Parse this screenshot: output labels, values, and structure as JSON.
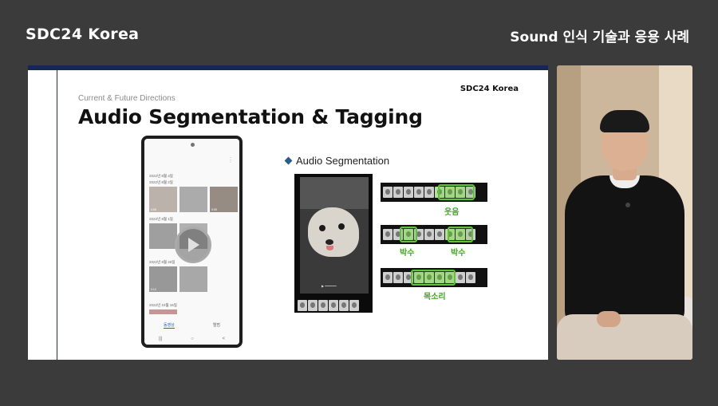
{
  "header": {
    "brand": "SDC24 Korea",
    "session_title": "Sound 인식 기술과 응용 사례"
  },
  "slide": {
    "brand": "SDC24 Korea",
    "eyebrow": "Current & Future Directions",
    "title": "Audio Segmentation & Tagging",
    "section_heading": "Audio Segmentation",
    "phone": {
      "dates": [
        "2022년 8월 4일",
        "2022년 8월 2일",
        "2022년 8월 1일",
        "2022년 8월 26일",
        "2022년 10월 16일"
      ],
      "durations": [
        "0:08",
        "0:05",
        "0:12"
      ],
      "tabs": [
        "동영상",
        "앨범"
      ],
      "active_tab": "동영상"
    },
    "segments": [
      {
        "label": "웃음"
      },
      {
        "label_left": "박수",
        "label_right": "박수"
      },
      {
        "label": "목소리"
      }
    ]
  },
  "colors": {
    "background": "#3b3b3b",
    "slide_accent": "#14265a",
    "segment_green": "#5fc33a"
  }
}
